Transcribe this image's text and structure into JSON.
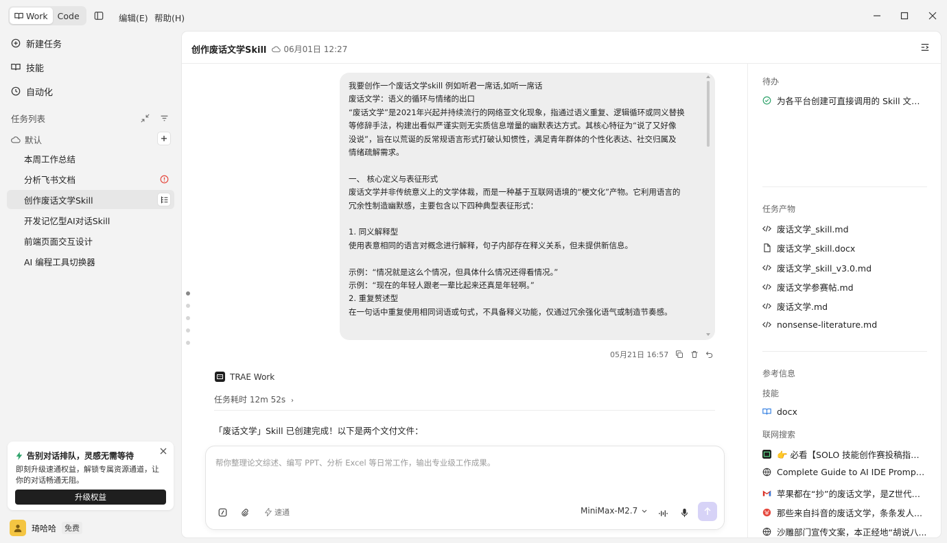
{
  "titlebar": {
    "tabs": [
      {
        "label": "Work",
        "active": true
      },
      {
        "label": "Code",
        "active": false
      }
    ],
    "menus": [
      "编辑(E)",
      "帮助(H)"
    ]
  },
  "sidebar": {
    "nav": [
      {
        "label": "新建任务",
        "icon": "plus-circle-icon"
      },
      {
        "label": "技能",
        "icon": "book-icon"
      },
      {
        "label": "自动化",
        "icon": "clock-icon"
      }
    ],
    "task_list_title": "任务列表",
    "group_label": "默认",
    "tasks": [
      {
        "label": "本周工作总结",
        "status": ""
      },
      {
        "label": "分析飞书文档",
        "status": "error"
      },
      {
        "label": "创作废话文学Skill",
        "status": "active"
      },
      {
        "label": "开发记忆型AI对话Skill",
        "status": ""
      },
      {
        "label": "前端页面交互设计",
        "status": ""
      },
      {
        "label": "AI 编程工具切换器",
        "status": ""
      }
    ],
    "promo": {
      "title": "告别对话排队，灵感无需等待",
      "desc": "即刻升级速通权益，解锁专属资源通道，让你的对话畅通无阻。",
      "button": "升级权益"
    },
    "user": {
      "name": "琦哈哈",
      "plan": "免费"
    }
  },
  "main": {
    "title": "创作废话文学Skill",
    "date": "06月01日 12:27",
    "message_lines": [
      "我要创作一个废话文学skill  例如听君一席话,如听一席话",
      "废话文学：语义的循环与情绪的出口",
      "“废话文学”是2021年兴起并持续流行的网络亚文化现象，指通过语义重复、逻辑循环或同义替换",
      "等修辞手法，构建出看似严谨实则无实质信息增量的幽默表达方式。其核心特征为“说了又好像",
      "没说”，旨在以荒诞的反常规语言形式打破认知惯性，满足青年群体的个性化表达、社交归属及",
      "情绪疏解需求。",
      "",
      "一、  核心定义与表征形式",
      "废话文学并非传统意义上的文学体裁，而是一种基于互联网语境的“梗文化”产物。它利用语言的",
      "冗余性制造幽默感，主要包含以下四种典型表征形式：",
      "",
      "1. 同义解释型",
      "使用表意相同的语言对概念进行解释，句子内部存在释义关系，但未提供新信息。",
      "",
      "示例：“情况就是这么个情况，但具体什么情况还得看情况。”",
      "示例：“现在的年轻人跟老一辈比起来还真是年轻啊。”",
      "2. 重复赘述型",
      "在一句话中重复使用相同词语或句式，不具备释义功能，仅通过冗余强化语气或制造节奏感。"
    ],
    "message_time": "05月21日 16:57",
    "agent_name": "TRAE Work",
    "duration": "任务耗时 12m 52s",
    "reply": "「废话文学」Skill 已创建完成！以下是两个文付文件：",
    "composer": {
      "placeholder": "帮你整理论文综述、编写 PPT、分析 Excel 等日常工作，输出专业级工作成果。",
      "speed": "速通",
      "model": "MiniMax-M2.7"
    }
  },
  "rpanel": {
    "todo_title": "待办",
    "todo": "为各平台创建可直接调用的 Skill 文件...",
    "artifacts_title": "任务产物",
    "artifacts": [
      {
        "name": "废话文学_skill.md",
        "icon": "code-icon"
      },
      {
        "name": "废话文学_skill.docx",
        "icon": "file-icon"
      },
      {
        "name": "废话文学_skill_v3.0.md",
        "icon": "code-icon"
      },
      {
        "name": "废话文学参赛帖.md",
        "icon": "code-icon"
      },
      {
        "name": "废话文学.md",
        "icon": "code-icon"
      },
      {
        "name": "nonsense-literature.md",
        "icon": "code-icon"
      }
    ],
    "ref_title": "参考信息",
    "skills_title": "技能",
    "skill": "docx",
    "web_title": "联网搜索",
    "web": [
      {
        "title": "👉 必看【SOLO 技能创作赛投稿指南...",
        "icon": "trae-icon"
      },
      {
        "title": "Complete Guide to AI IDE Prompt For...",
        "icon": "globe-icon"
      },
      {
        "title": "苹果都在“抄”的废话文学，是Z世代的...",
        "icon": "gmail-icon"
      },
      {
        "title": "那些来自抖音的废话文学，条条发人...",
        "icon": "pig-icon"
      },
      {
        "title": "沙雕部门宣传文案，本正经地“胡说八...",
        "icon": "globe-icon"
      }
    ]
  },
  "colors": {
    "accent": "#d7d3f7",
    "error": "#e5483d",
    "success": "#2fa36b",
    "sidebar": "#f3f3f3"
  }
}
